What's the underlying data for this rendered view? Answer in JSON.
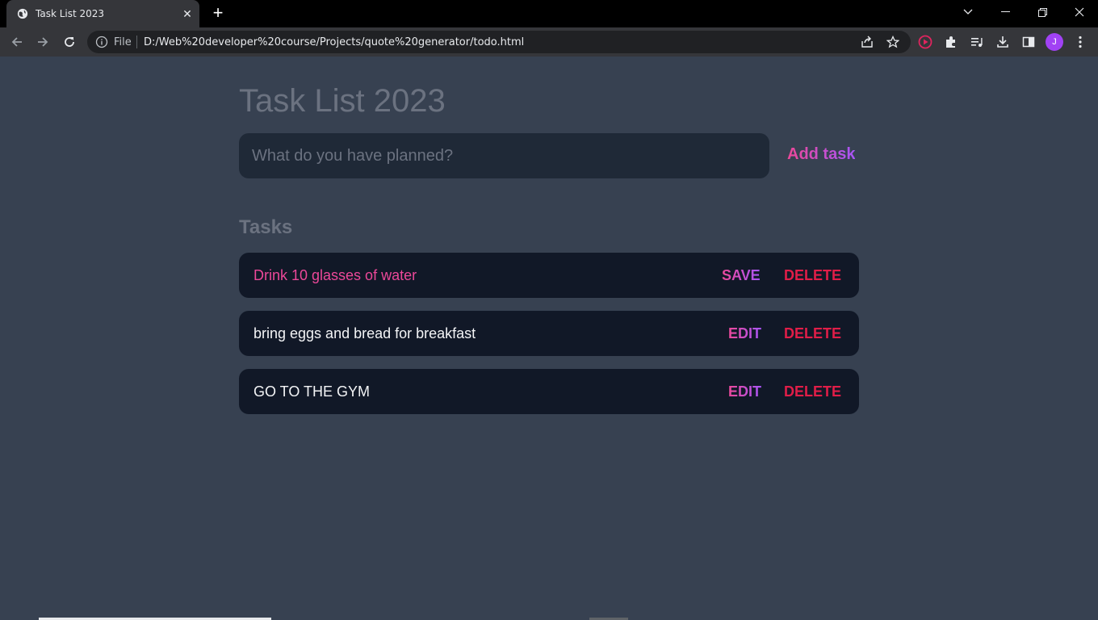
{
  "browser": {
    "tab_title": "Task List 2023",
    "omnibox_scheme": "File",
    "url": "D:/Web%20developer%20course/Projects/quote%20generator/todo.html",
    "profile_initial": "J"
  },
  "app": {
    "title": "Task List 2023",
    "input_placeholder": "What do you have planned?",
    "add_button": "Add task",
    "tasks_heading": "Tasks",
    "tasks": [
      {
        "text": "Drink 10 glasses of water",
        "primary_action": "SAVE",
        "delete_action": "DELETE",
        "editing": true
      },
      {
        "text": "bring eggs and bread for breakfast",
        "primary_action": "EDIT",
        "delete_action": "DELETE",
        "editing": false
      },
      {
        "text": "GO TO THE GYM",
        "primary_action": "EDIT",
        "delete_action": "DELETE",
        "editing": false
      }
    ]
  },
  "colors": {
    "page_bg": "#374151",
    "card_bg": "#111827",
    "input_bg": "#1f2937",
    "accent_pink": "#ec4899",
    "accent_purple": "#a855f7",
    "delete_red": "#e11d48"
  }
}
